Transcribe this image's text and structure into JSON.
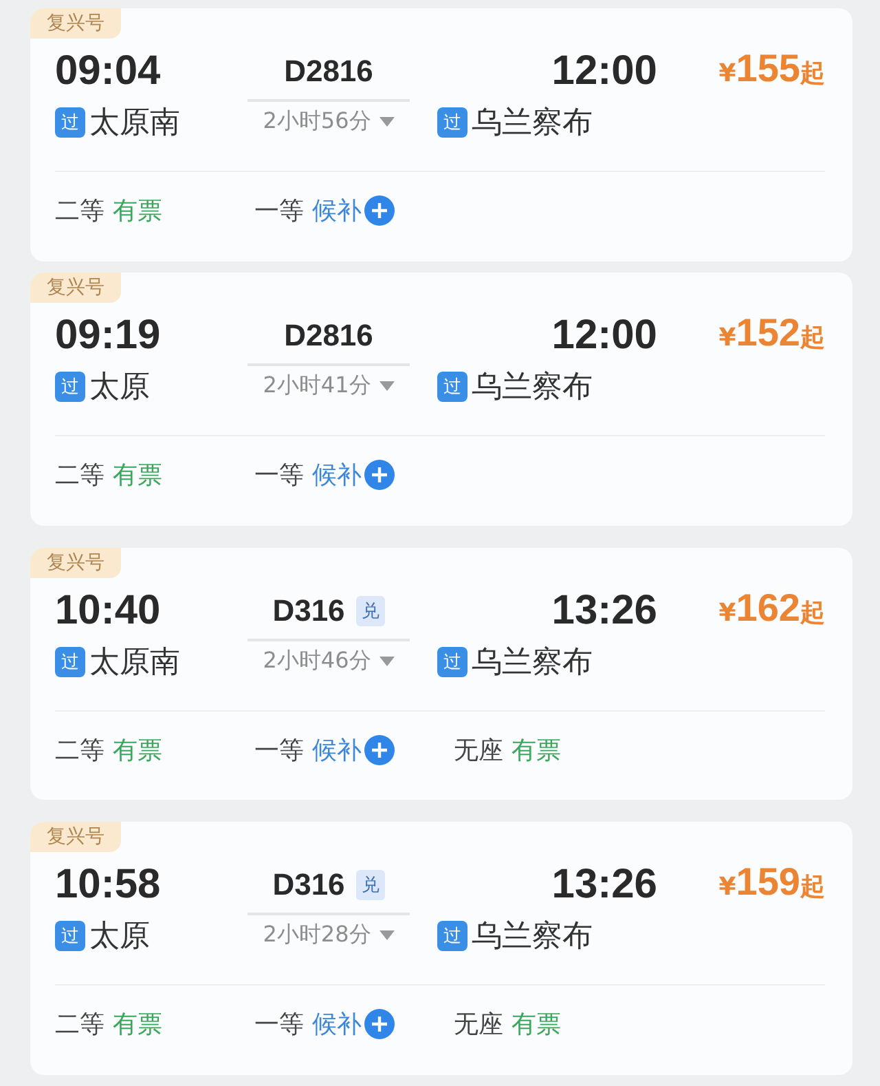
{
  "trains": [
    {
      "badge": "复兴号",
      "depart_time": "09:04",
      "train_no": "D2816",
      "redeem": false,
      "duration": "2小时56分",
      "arrive_time": "12:00",
      "price_symbol": "¥",
      "price": "155",
      "price_suffix": "起",
      "depart_tag": "过",
      "depart_station": "太原南",
      "arrive_tag": "过",
      "arrive_station": "乌兰察布",
      "seats": [
        {
          "class": "二等",
          "status": "有票",
          "kind": "available"
        },
        {
          "class": "一等",
          "status": "候补",
          "kind": "waitlist"
        }
      ]
    },
    {
      "badge": "复兴号",
      "depart_time": "09:19",
      "train_no": "D2816",
      "redeem": false,
      "duration": "2小时41分",
      "arrive_time": "12:00",
      "price_symbol": "¥",
      "price": "152",
      "price_suffix": "起",
      "depart_tag": "过",
      "depart_station": "太原",
      "arrive_tag": "过",
      "arrive_station": "乌兰察布",
      "seats": [
        {
          "class": "二等",
          "status": "有票",
          "kind": "available"
        },
        {
          "class": "一等",
          "status": "候补",
          "kind": "waitlist"
        }
      ]
    },
    {
      "badge": "复兴号",
      "depart_time": "10:40",
      "train_no": "D316",
      "redeem": true,
      "redeem_label": "兑",
      "duration": "2小时46分",
      "arrive_time": "13:26",
      "price_symbol": "¥",
      "price": "162",
      "price_suffix": "起",
      "depart_tag": "过",
      "depart_station": "太原南",
      "arrive_tag": "过",
      "arrive_station": "乌兰察布",
      "seats": [
        {
          "class": "二等",
          "status": "有票",
          "kind": "available"
        },
        {
          "class": "一等",
          "status": "候补",
          "kind": "waitlist"
        },
        {
          "class": "无座",
          "status": "有票",
          "kind": "available"
        }
      ]
    },
    {
      "badge": "复兴号",
      "depart_time": "10:58",
      "train_no": "D316",
      "redeem": true,
      "redeem_label": "兑",
      "duration": "2小时28分",
      "arrive_time": "13:26",
      "price_symbol": "¥",
      "price": "159",
      "price_suffix": "起",
      "depart_tag": "过",
      "depart_station": "太原",
      "arrive_tag": "过",
      "arrive_station": "乌兰察布",
      "seats": [
        {
          "class": "二等",
          "status": "有票",
          "kind": "available"
        },
        {
          "class": "一等",
          "status": "候补",
          "kind": "waitlist"
        },
        {
          "class": "无座",
          "status": "有票",
          "kind": "available"
        }
      ]
    }
  ]
}
